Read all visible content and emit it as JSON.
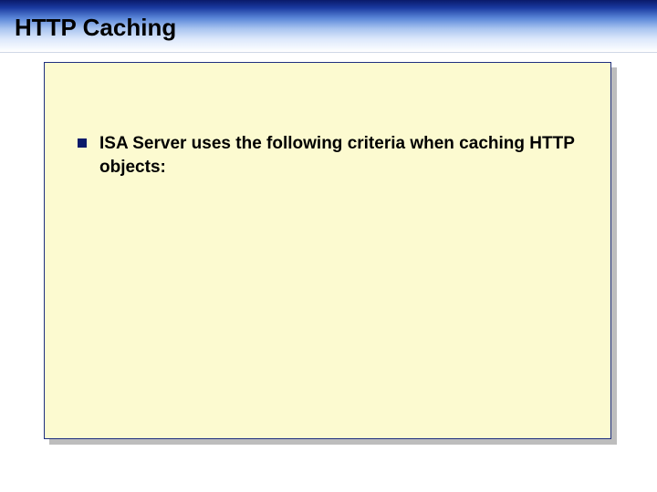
{
  "title": "HTTP Caching",
  "bullets": [
    {
      "text": "ISA Server uses the following criteria when caching HTTP objects:"
    }
  ]
}
